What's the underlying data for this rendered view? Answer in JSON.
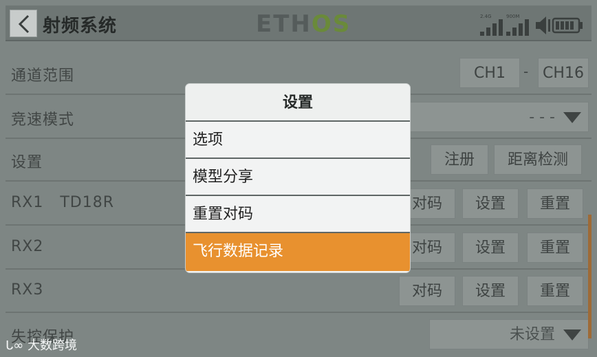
{
  "header": {
    "title": "射频系统",
    "logo_main": "ETH",
    "logo_accent": "OS",
    "signal_2g4": "2.4G",
    "signal_900m": "900M"
  },
  "rows": {
    "channel_range": {
      "label": "通道范围",
      "start": "CH1",
      "sep": "-",
      "end": "CH16"
    },
    "race_mode": {
      "label": "竞速模式",
      "value": "- - -"
    },
    "settings": {
      "label": "设置",
      "register": "注册",
      "range_check": "距离检测"
    },
    "rx1": {
      "label": "RX1   TD18R",
      "bind": "对码",
      "setup": "设置",
      "reset": "重置"
    },
    "rx2": {
      "label": "RX2",
      "bind": "对码",
      "setup": "设置",
      "reset": "重置"
    },
    "rx3": {
      "label": "RX3",
      "bind": "对码",
      "setup": "设置",
      "reset": "重置"
    },
    "failsafe": {
      "label": "失控保护",
      "value": "未设置"
    }
  },
  "popup": {
    "title": "设置",
    "items": [
      "选项",
      "模型分享",
      "重置对码",
      "飞行数据记录"
    ],
    "selected_index": 3
  },
  "watermark": "大数跨境",
  "colors": {
    "accent": "#e8912f",
    "background": "#7e8684",
    "popup_bg": "#f2f3f3"
  }
}
